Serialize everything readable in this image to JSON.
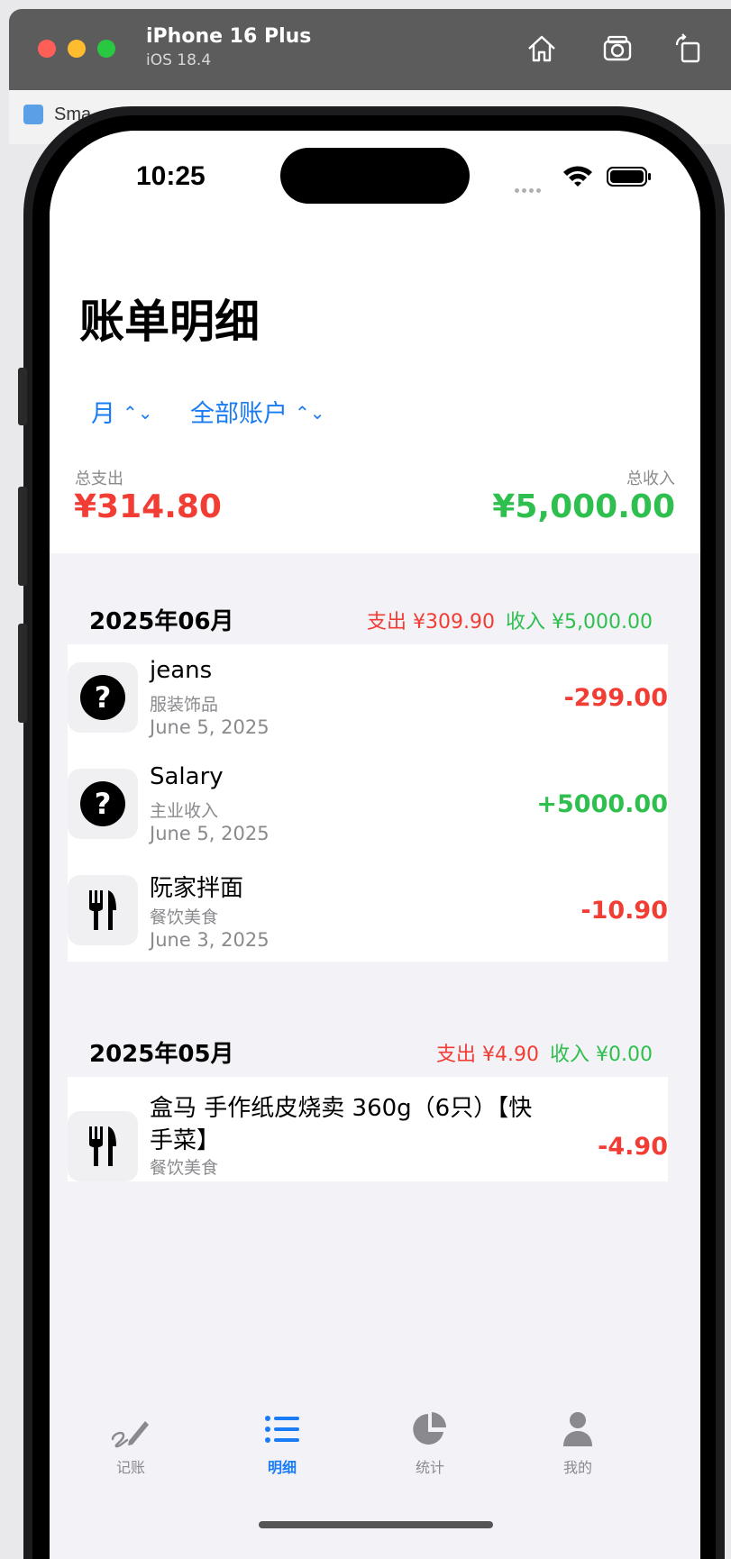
{
  "simulator": {
    "device_name": "iPhone 16 Plus",
    "os_version": "iOS 18.4",
    "home_icon": "home-icon",
    "screenshot_icon": "camera-icon",
    "rotate_icon": "rotate-icon"
  },
  "xcode": {
    "label": "Sma"
  },
  "status_bar": {
    "time": "10:25"
  },
  "page": {
    "title": "账单明细"
  },
  "filters": {
    "period": "月",
    "account": "全部账户",
    "chevron": "⌃⌄"
  },
  "summary": {
    "expense_label": "总支出",
    "expense_value": "¥314.80",
    "income_label": "总收入",
    "income_value": "¥5,000.00"
  },
  "months": [
    {
      "title": "2025年06月",
      "expense": "支出 ¥309.90",
      "income": "收入 ¥5,000.00",
      "items": [
        {
          "name": "jeans",
          "category": "服装饰品",
          "date": "June 5, 2025",
          "amount": "-299.00",
          "icon": "question-icon"
        },
        {
          "name": "Salary",
          "category": "主业收入",
          "date": "June 5, 2025",
          "amount": "+5000.00",
          "icon": "question-icon"
        },
        {
          "name": "阮家拌面",
          "category": "餐饮美食",
          "date": "June 3, 2025",
          "amount": "-10.90",
          "icon": "fork-knife-icon"
        }
      ]
    },
    {
      "title": "2025年05月",
      "expense": "支出 ¥4.90",
      "income": "收入 ¥0.00",
      "items": [
        {
          "name_line1": "盒马 手作纸皮烧卖 360g（6只）【快",
          "name_line2": "手菜】",
          "category": "餐饮美食",
          "amount": "-4.90",
          "icon": "fork-knife-icon"
        }
      ]
    }
  ],
  "tabs": [
    {
      "label": "记账",
      "icon": "pencil-scribble-icon"
    },
    {
      "label": "明细",
      "icon": "list-icon"
    },
    {
      "label": "统计",
      "icon": "pie-chart-icon"
    },
    {
      "label": "我的",
      "icon": "person-icon"
    }
  ],
  "colors": {
    "accent": "#1a7cf5",
    "expense": "#f23d35",
    "income": "#2fbf4f",
    "secondary_text": "#8a8a8e"
  }
}
